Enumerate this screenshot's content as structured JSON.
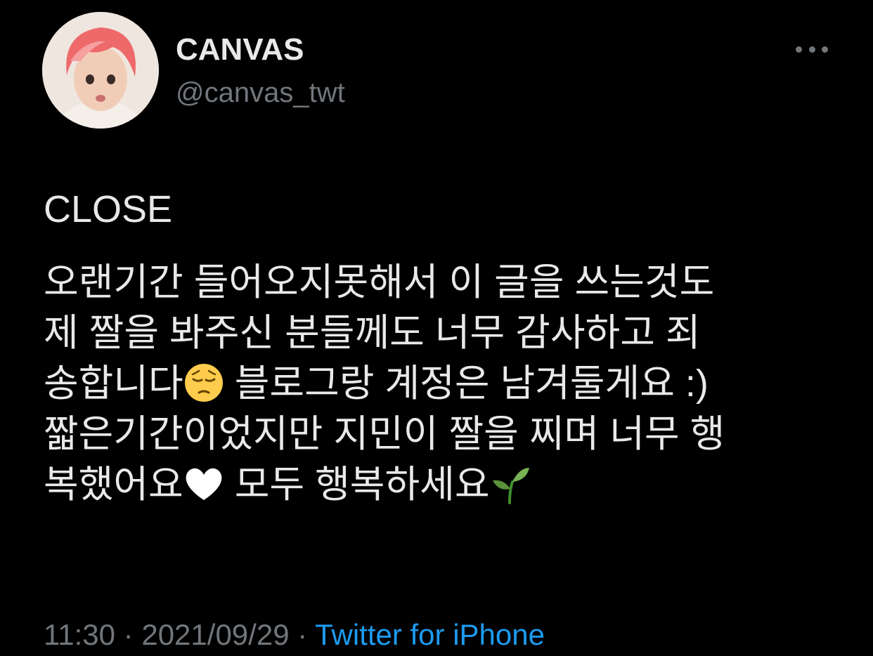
{
  "author": {
    "display_name": "CANVAS",
    "handle": "@canvas_twt"
  },
  "tweet": {
    "lines": [
      "CLOSE",
      "오랜기간 들어오지못해서 이 글을 쓰는것도",
      "제 짤을 봐주신 분들께도 너무 감사하고 죄",
      "송합니다",
      "블로그랑 계정은 남겨둘게요 :)",
      "짧은기간이었지만 지민이 짤을 찌며 너무 행",
      "복했어요",
      "모두 행복하세요"
    ],
    "emojis": [
      "pensive-face-emoji",
      "white-heart-emoji",
      "seedling-emoji"
    ]
  },
  "meta": {
    "time": "11:30",
    "separator": "·",
    "date": "2021/09/29",
    "source": "Twitter for iPhone"
  },
  "colors": {
    "background": "#000000",
    "text": "#e7e9ea",
    "secondary": "#71767b",
    "link": "#1d9bf0"
  }
}
